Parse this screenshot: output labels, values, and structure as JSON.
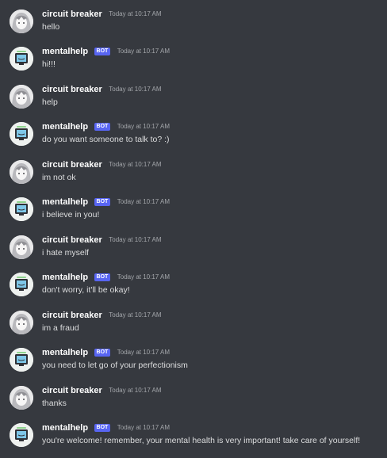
{
  "users": {
    "human": {
      "name": "circuit breaker",
      "avatar_icon": "anime-girl-avatar-icon"
    },
    "bot": {
      "name": "mentalhelp",
      "badge": "BOT",
      "avatar_icon": "monitor-face-avatar-icon"
    }
  },
  "colors": {
    "background": "#36393f",
    "bot_badge": "#5865f2",
    "author": "#ffffff",
    "text": "#dcddde",
    "timestamp": "#a3a6aa"
  },
  "messages": [
    {
      "author": "circuit breaker",
      "time": "Today at 10:17 AM",
      "text": "hello"
    },
    {
      "author": "mentalhelp",
      "badge": "BOT",
      "time": "Today at 10:17 AM",
      "text": "hi!!!"
    },
    {
      "author": "circuit breaker",
      "time": "Today at 10:17 AM",
      "text": "help"
    },
    {
      "author": "mentalhelp",
      "badge": "BOT",
      "time": "Today at 10:17 AM",
      "text": "do you want someone to talk to? :)"
    },
    {
      "author": "circuit breaker",
      "time": "Today at 10:17 AM",
      "text": "im not ok"
    },
    {
      "author": "mentalhelp",
      "badge": "BOT",
      "time": "Today at 10:17 AM",
      "text": "i believe in you!"
    },
    {
      "author": "circuit breaker",
      "time": "Today at 10:17 AM",
      "text": "i hate myself"
    },
    {
      "author": "mentalhelp",
      "badge": "BOT",
      "time": "Today at 10:17 AM",
      "text": "don't worry, it'll be okay!"
    },
    {
      "author": "circuit breaker",
      "time": "Today at 10:17 AM",
      "text": "im a fraud"
    },
    {
      "author": "mentalhelp",
      "badge": "BOT",
      "time": "Today at 10:17 AM",
      "text": "you need to let go of your perfectionism"
    },
    {
      "author": "circuit breaker",
      "time": "Today at 10:17 AM",
      "text": "thanks"
    },
    {
      "author": "mentalhelp",
      "badge": "BOT",
      "time": "Today at 10:17 AM",
      "text": "you're welcome! remember, your mental health is very important! take care of yourself!"
    }
  ]
}
